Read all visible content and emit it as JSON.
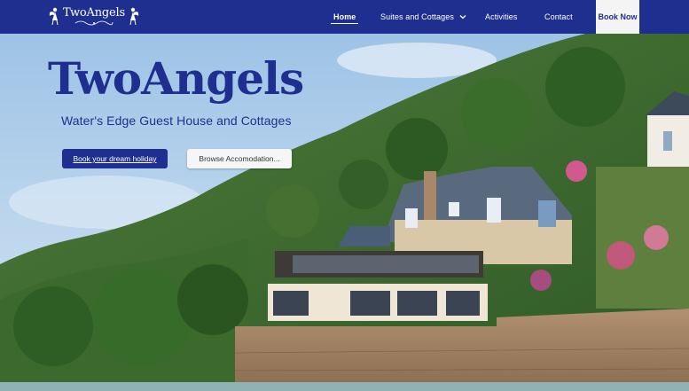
{
  "colors": {
    "brand": "#1f2f8f",
    "nav_text": "#ffffff",
    "book_now_bg": "#f4f4f4",
    "secondary_button_bg": "#f6f6f6"
  },
  "logo": {
    "text": "TwoAngels",
    "icon": "angel-icon"
  },
  "nav": {
    "items": [
      {
        "label": "Home",
        "active": true
      },
      {
        "label": "Suites and Cottages",
        "has_dropdown": true,
        "icon": "chevron-down-icon"
      },
      {
        "label": "Activities"
      },
      {
        "label": "Contact"
      }
    ],
    "cta_label": "Book Now"
  },
  "hero": {
    "title": "TwoAngels",
    "subtitle": "Water's Edge Guest House and Cottages",
    "primary_button": "Book your dream holiday",
    "secondary_button": "Browse Accomodation..."
  }
}
